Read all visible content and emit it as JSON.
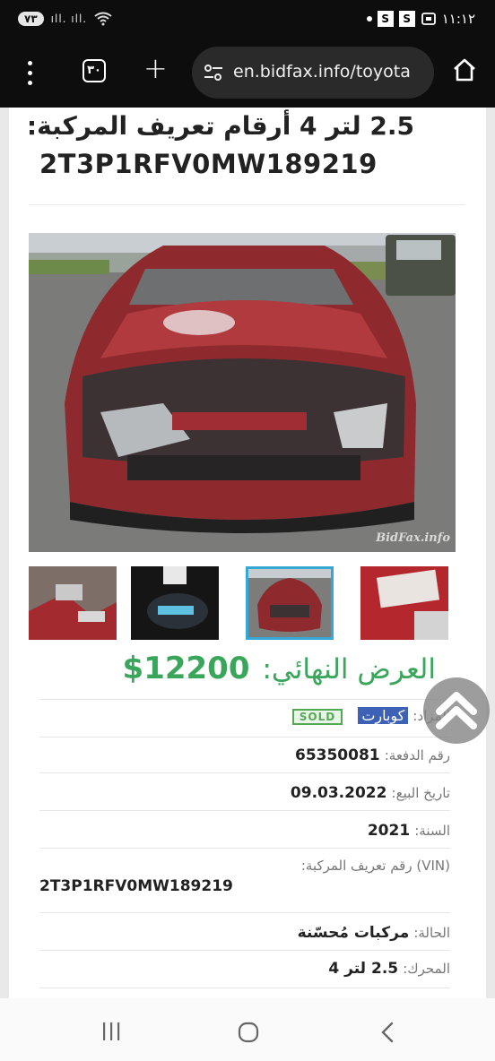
{
  "status_bar": {
    "badge": "٧٣",
    "signal": "ıll. ıll.",
    "right_s1": "S",
    "right_s2": "S",
    "time": "١١:١٢"
  },
  "browser": {
    "tab_count": "٣٠",
    "url": "en.bidfax.info/toyota"
  },
  "listing": {
    "title": "2.5 لتر 4 أرقام تعريف المركبة:",
    "title_vin": "2T3P1RFV0MW189219",
    "watermark": "BidFax.info",
    "final_offer_label": "العرض النهائي:",
    "final_offer_value": "12200$",
    "auction_label": "المزاد:",
    "auction_value": "كوبارت",
    "sold_badge": "SOLD",
    "rows": [
      {
        "label": "رقم الدفعة:",
        "value": "65350081"
      },
      {
        "label": "تاريخ البيع:",
        "value": "09.03.2022"
      },
      {
        "label": "السنة:",
        "value": "2021"
      },
      {
        "label": "(VIN) رقم تعريف المركبة:",
        "value": "2T3P1RFV0MW189219"
      },
      {
        "label": "الحالة:",
        "value": "مركبات مُحسّنة"
      },
      {
        "label": "المحرك:",
        "value": "2.5 لتر 4"
      }
    ]
  },
  "icons": {
    "menu": "more-vert-icon",
    "tabs": "tabs-icon",
    "add": "plus-icon",
    "site_settings": "tune-icon",
    "home": "home-icon",
    "scroll_top": "chevron-up-icon",
    "nav_recents": "recents-icon",
    "nav_home": "home-circle-icon",
    "nav_back": "back-icon"
  }
}
